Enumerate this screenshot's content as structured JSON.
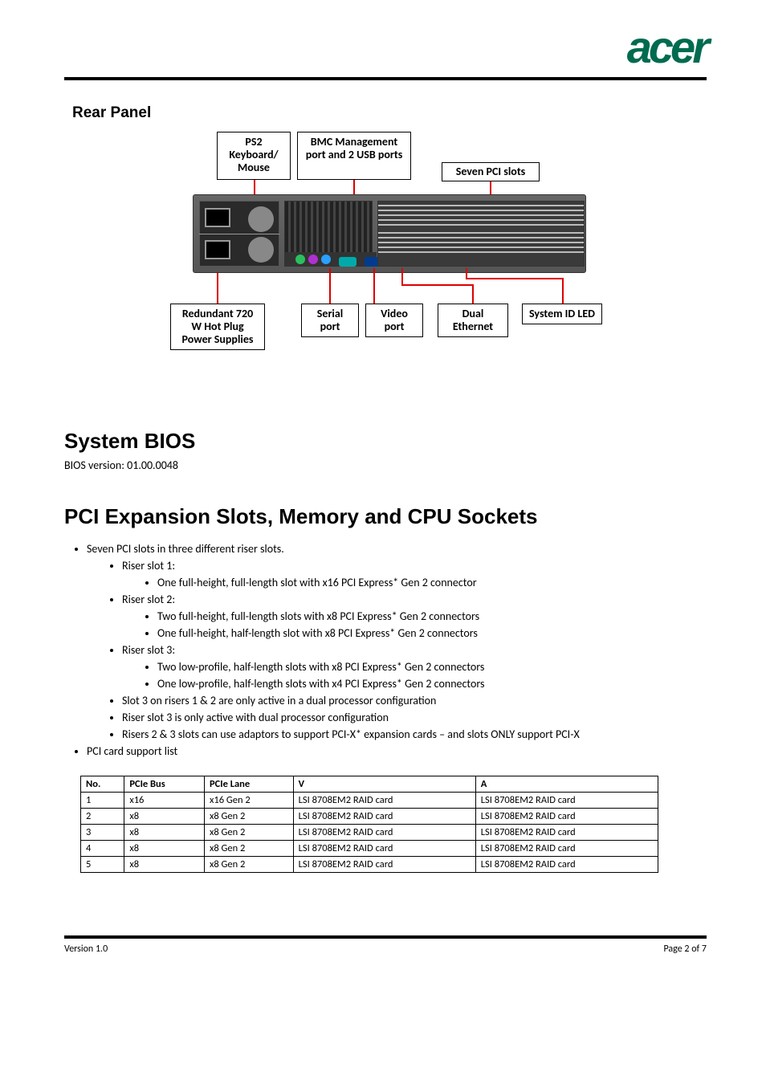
{
  "brand": "acer",
  "rear_panel": {
    "title": "Rear Panel",
    "callout_top_1": "PS2 Keyboard/ Mouse",
    "callout_top_2": "BMC Management port and 2 USB ports",
    "callout_top_3": "Seven PCI slots",
    "callout_bottom_1": "Redundant 720 W Hot Plug Power Supplies",
    "callout_bottom_2": "Serial port",
    "callout_bottom_3": "Video port",
    "callout_bottom_4": "Dual Ethernet",
    "callout_bottom_5": "System ID LED"
  },
  "bios": {
    "heading": "System BIOS",
    "version": "BIOS version: 01.00.0048"
  },
  "pci": {
    "heading": "PCI Expansion Slots, Memory and CPU Sockets",
    "bullets": {
      "b1": "Seven PCI slots in three different riser slots.",
      "b1_1": "Riser slot 1:",
      "b1_1_1": "One  full-height, full-length slot with x16 PCI Express* Gen 2 connector",
      "b1_2": "Riser slot 2:",
      "b1_2_1": "Two full-height, full-length slots with x8 PCI Express* Gen 2 connectors",
      "b1_2_2": "One  full-height, half-length slot with x8 PCI Express* Gen 2 connectors",
      "b1_3": "Riser slot 3:",
      "b1_3_1": "Two low-profile, half-length slots with x8 PCI Express* Gen 2 connectors",
      "b1_3_2": "One  low-profile, half-length slots with x4 PCI Express* Gen 2 connectors",
      "b1_4": "Slot 3 on risers 1 & 2 are only active in a dual processor configuration",
      "b1_5": "Riser slot 3 is only active with dual processor configuration",
      "b1_6": "Risers 2 & 3 slots can use adaptors to support PCI-X* expansion cards – and slots ONLY support PCI-X",
      "b2": "PCI card support list"
    },
    "table": {
      "headers": [
        "No.",
        "PCIe Bus",
        "PCIe Lane",
        "V",
        "A"
      ],
      "rows": [
        [
          "1",
          "x16",
          "x16 Gen 2",
          "LSI  8708EM2 RAID card",
          "LSI  8708EM2 RAID card"
        ],
        [
          "2",
          "x8",
          "x8 Gen 2",
          "LSI  8708EM2 RAID card",
          "LSI  8708EM2 RAID card"
        ],
        [
          "3",
          "x8",
          "x8 Gen 2",
          "LSI  8708EM2 RAID card",
          "LSI  8708EM2 RAID card"
        ],
        [
          "4",
          "x8",
          "x8 Gen 2",
          "LSI  8708EM2 RAID card",
          "LSI  8708EM2 RAID card"
        ],
        [
          "5",
          "x8",
          "x8 Gen 2",
          "LSI  8708EM2 RAID card",
          "LSI  8708EM2 RAID card"
        ]
      ]
    }
  },
  "footer": {
    "left": "Version 1.0",
    "right": "Page 2 of 7"
  }
}
